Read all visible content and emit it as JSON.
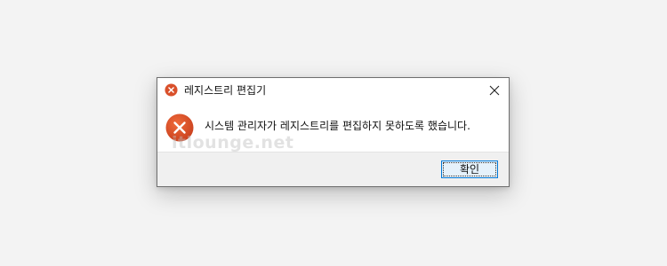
{
  "dialog": {
    "title": "레지스트리 편집기",
    "message": "시스템 관리자가 레지스트리를 편집하지 못하도록 했습니다.",
    "ok_label": "확인",
    "close_glyph": "✕"
  },
  "watermark": {
    "text": "itlounge.net"
  },
  "colors": {
    "error_red": "#d9502b",
    "accent_border": "#0078d7",
    "button_fill": "#e5f1fb",
    "footer_bg": "#f0f0f0",
    "page_bg": "#f3f3f3"
  },
  "icons": {
    "title_icon": "error-icon",
    "message_icon": "error-icon",
    "close_icon": "close-icon"
  }
}
